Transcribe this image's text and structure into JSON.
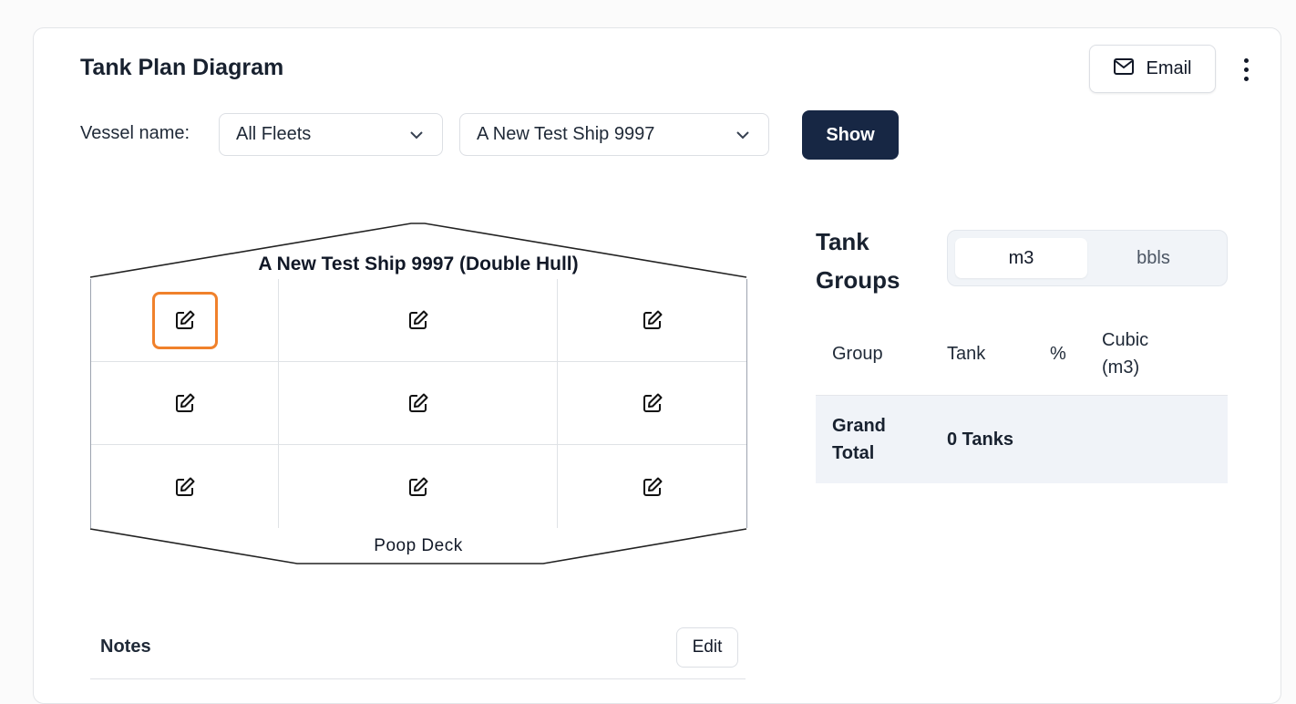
{
  "header": {
    "title": "Tank Plan Diagram",
    "email_label": "Email",
    "more_icon": "more-vertical-icon"
  },
  "filters": {
    "vessel_label": "Vessel name:",
    "fleet_selected": "All Fleets",
    "ship_selected": "A New Test Ship 9997",
    "show_label": "Show"
  },
  "diagram": {
    "ship_title": "A New Test Ship 9997 (Double Hull)",
    "stern_label": "Poop Deck",
    "tank_rows": 3,
    "tank_cols": 3,
    "focused_cell": "row 1, col 1",
    "highlight_color": "#f0812b"
  },
  "notes": {
    "label": "Notes",
    "edit_label": "Edit"
  },
  "tank_groups": {
    "title_line1": "Tank",
    "title_line2": "Groups",
    "units": [
      "m3",
      "bbls"
    ],
    "active_unit": "m3",
    "columns": [
      "Group",
      "Tank",
      "%",
      "Cubic (m3)"
    ],
    "grand_total": {
      "group": "Grand Total",
      "tank": "0 Tanks",
      "percent": "",
      "cubic": ""
    }
  },
  "colors": {
    "primary_button": "#172744",
    "table_highlight_row": "#f0f3f8"
  }
}
